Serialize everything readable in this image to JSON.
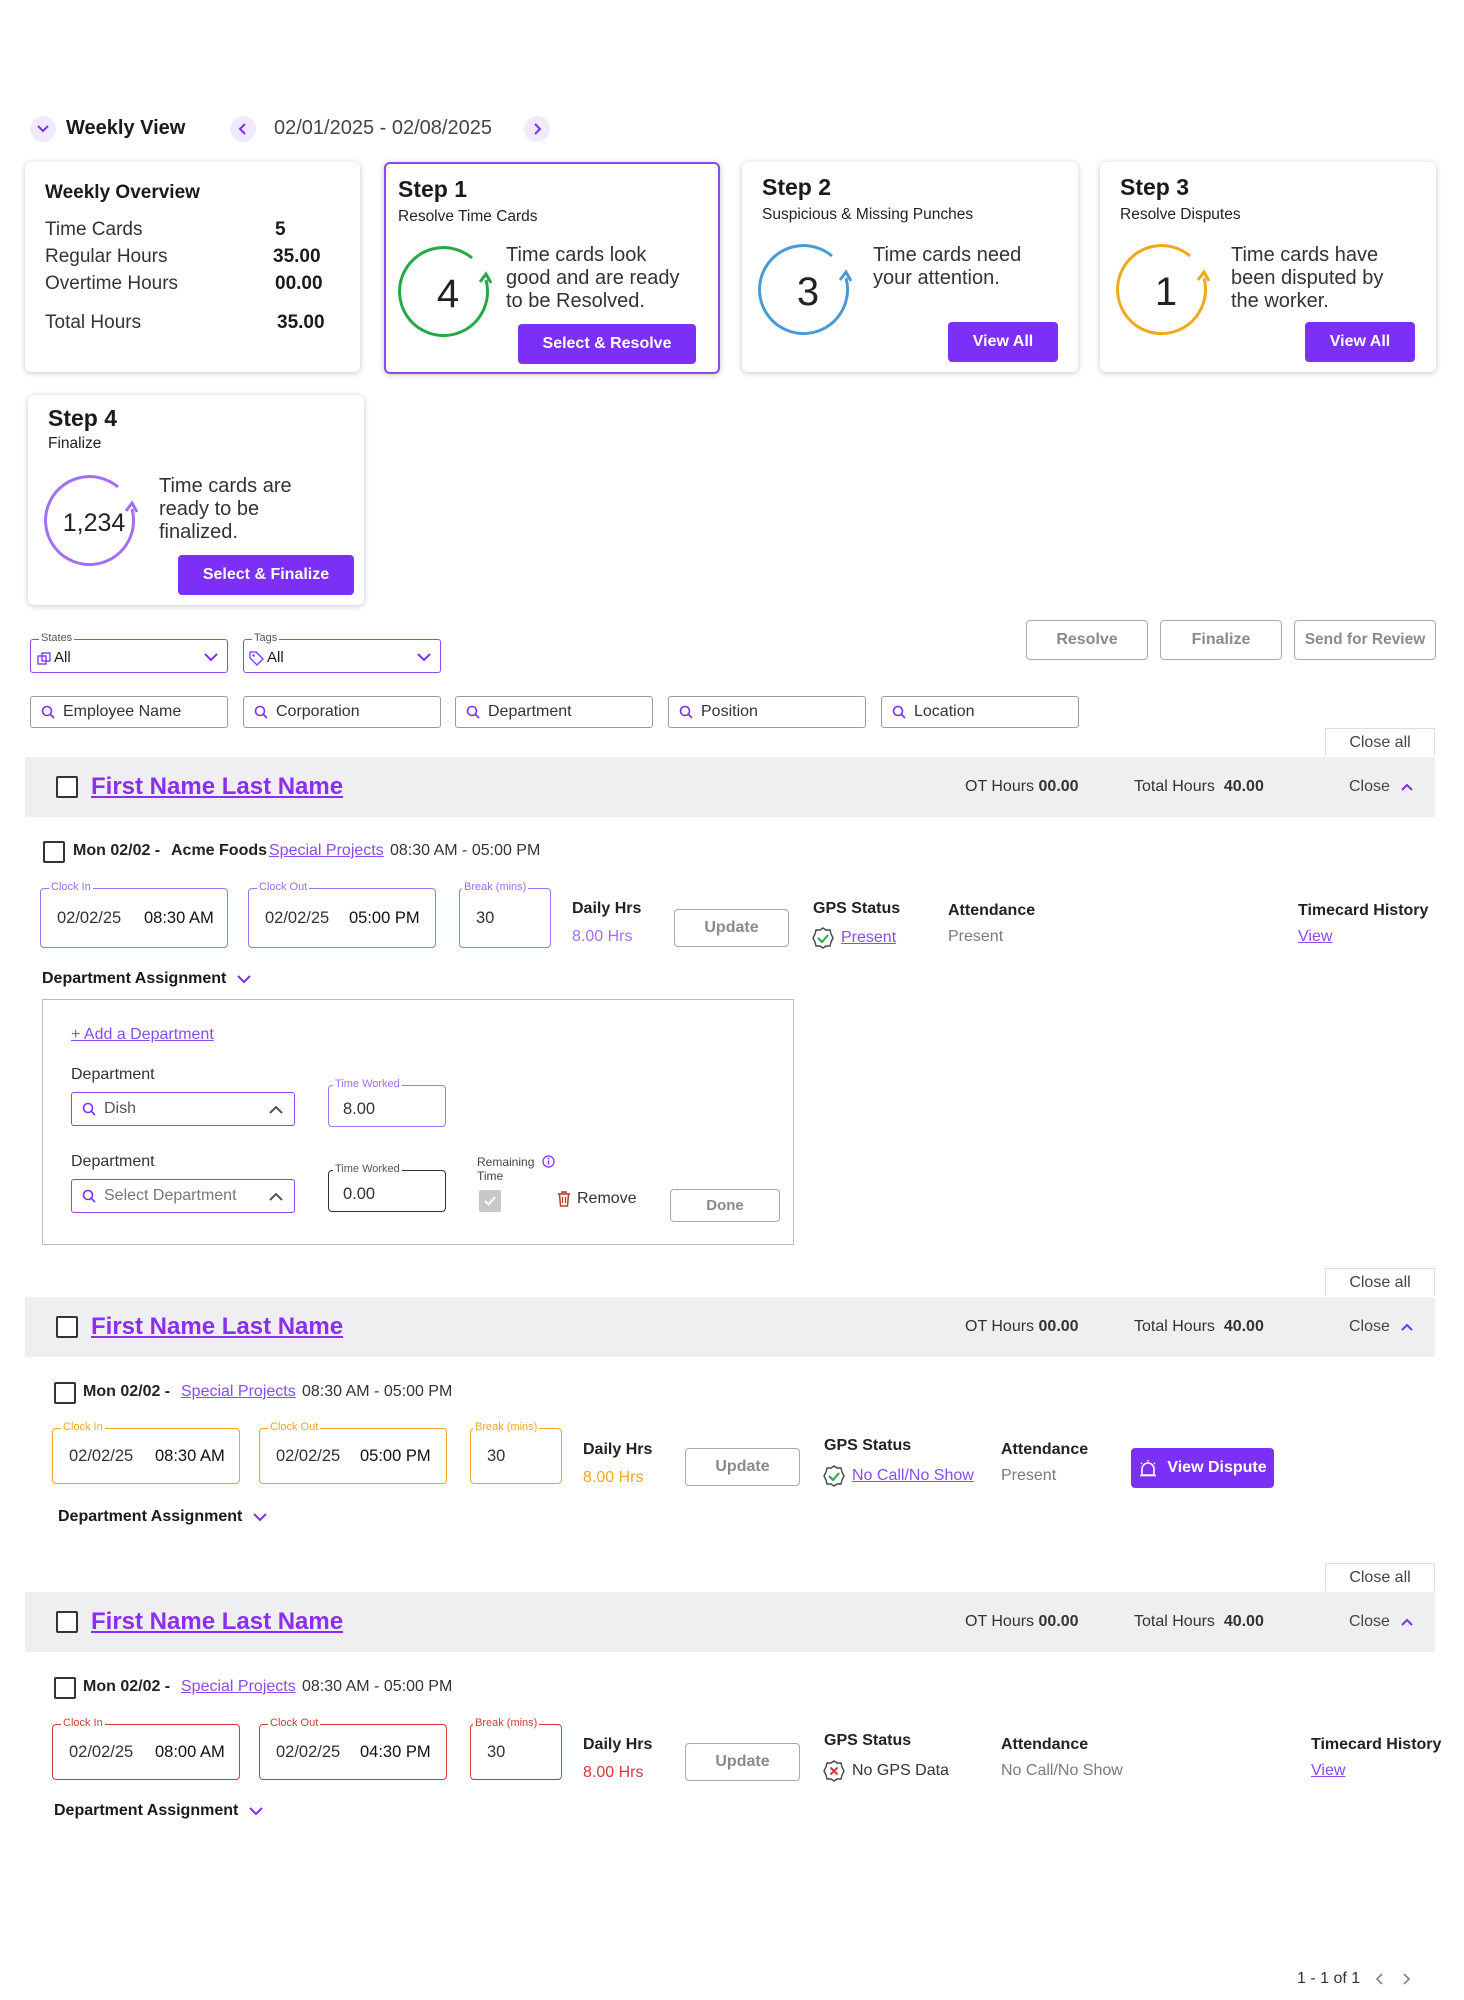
{
  "header": {
    "view_label": "Weekly View",
    "date_range": "02/01/2025 - 02/08/2025"
  },
  "overview": {
    "title": "Weekly Overview",
    "rows": [
      {
        "label": "Time Cards",
        "value": "5"
      },
      {
        "label": "Regular Hours",
        "value": "35.00"
      },
      {
        "label": "Overtime Hours",
        "value": "00.00"
      },
      {
        "label": "Total Hours",
        "value": "35.00"
      }
    ]
  },
  "steps": [
    {
      "title": "Step 1",
      "subtitle": "Resolve Time Cards",
      "count": "4",
      "text": "Time cards look good and are ready to be Resolved.",
      "button": "Select & Resolve",
      "color": "#27a844"
    },
    {
      "title": "Step 2",
      "subtitle": "Suspicious & Missing Punches",
      "count": "3",
      "text": "Time cards need your attention.",
      "button": "View All",
      "color": "#4a9ad4"
    },
    {
      "title": "Step 3",
      "subtitle": "Resolve Disputes",
      "count": "1",
      "text": "Time cards have been disputed by the worker.",
      "button": "View All",
      "color": "#f0a81c"
    },
    {
      "title": "Step 4",
      "subtitle": "Finalize",
      "count": "1,234",
      "text": "Time cards are ready to be finalized.",
      "button": "Select & Finalize",
      "color": "#a370f0"
    }
  ],
  "filters": {
    "states_label": "States",
    "states_value": "All",
    "tags_label": "Tags",
    "tags_value": "All",
    "search_fields": [
      "Employee Name",
      "Corporation",
      "Department",
      "Position",
      "Location"
    ]
  },
  "actions": {
    "resolve": "Resolve",
    "finalize": "Finalize",
    "send_review": "Send for Review"
  },
  "common": {
    "close_all": "Close all",
    "close": "Close",
    "ot_label": "OT Hours",
    "total_label": "Total Hours",
    "clock_in": "Clock In",
    "clock_out": "Clock Out",
    "break": "Break (mins)",
    "daily_hrs": "Daily Hrs",
    "update": "Update",
    "gps_status": "GPS Status",
    "attendance": "Attendance",
    "timecard_history": "Timecard History",
    "view": "View",
    "dept_assignment": "Department Assignment"
  },
  "employees": [
    {
      "name": "First Name Last Name",
      "ot": "00.00",
      "total": "40.00",
      "day": "Mon 02/02 -",
      "company": "Acme Foods",
      "project": "Special Projects",
      "shift": "08:30 AM - 05:00 PM",
      "in_date": "02/02/25",
      "in_time": "08:30 AM",
      "out_date": "02/02/25",
      "out_time": "05:00 PM",
      "break": "30",
      "daily": "8.00 Hrs",
      "gps": "Present",
      "attendance": "Present"
    },
    {
      "name": "First Name Last Name",
      "ot": "00.00",
      "total": "40.00",
      "day": "Mon 02/02 -",
      "project": "Special Projects",
      "shift": "08:30 AM - 05:00 PM",
      "in_date": "02/02/25",
      "in_time": "08:30 AM",
      "out_date": "02/02/25",
      "out_time": "05:00 PM",
      "break": "30",
      "daily": "8.00 Hrs",
      "gps": "No Call/No Show",
      "attendance": "Present",
      "dispute_button": "View Dispute"
    },
    {
      "name": "First Name Last Name",
      "ot": "00.00",
      "total": "40.00",
      "day": "Mon 02/02 -",
      "project": "Special Projects",
      "shift": "08:30 AM - 05:00 PM",
      "in_date": "02/02/25",
      "in_time": "08:00 AM",
      "out_date": "02/02/25",
      "out_time": "04:30 PM",
      "break": "30",
      "daily": "8.00 Hrs",
      "gps": "No GPS Data",
      "attendance": "No Call/No Show"
    }
  ],
  "dept_panel": {
    "add_link": "+ Add a Department",
    "dept_label": "Department",
    "dept1_value": "Dish",
    "time_worked_label": "Time Worked",
    "time1": "8.00",
    "dept2_placeholder": "Select Department",
    "time2": "0.00",
    "remaining_label": "Remaining Time",
    "remove": "Remove",
    "done": "Done"
  },
  "pagination": {
    "text": "1 - 1 of 1"
  },
  "colors": {
    "accent": "#7b2ff7",
    "warning": "#f0a81c",
    "error": "#d13b3b"
  }
}
